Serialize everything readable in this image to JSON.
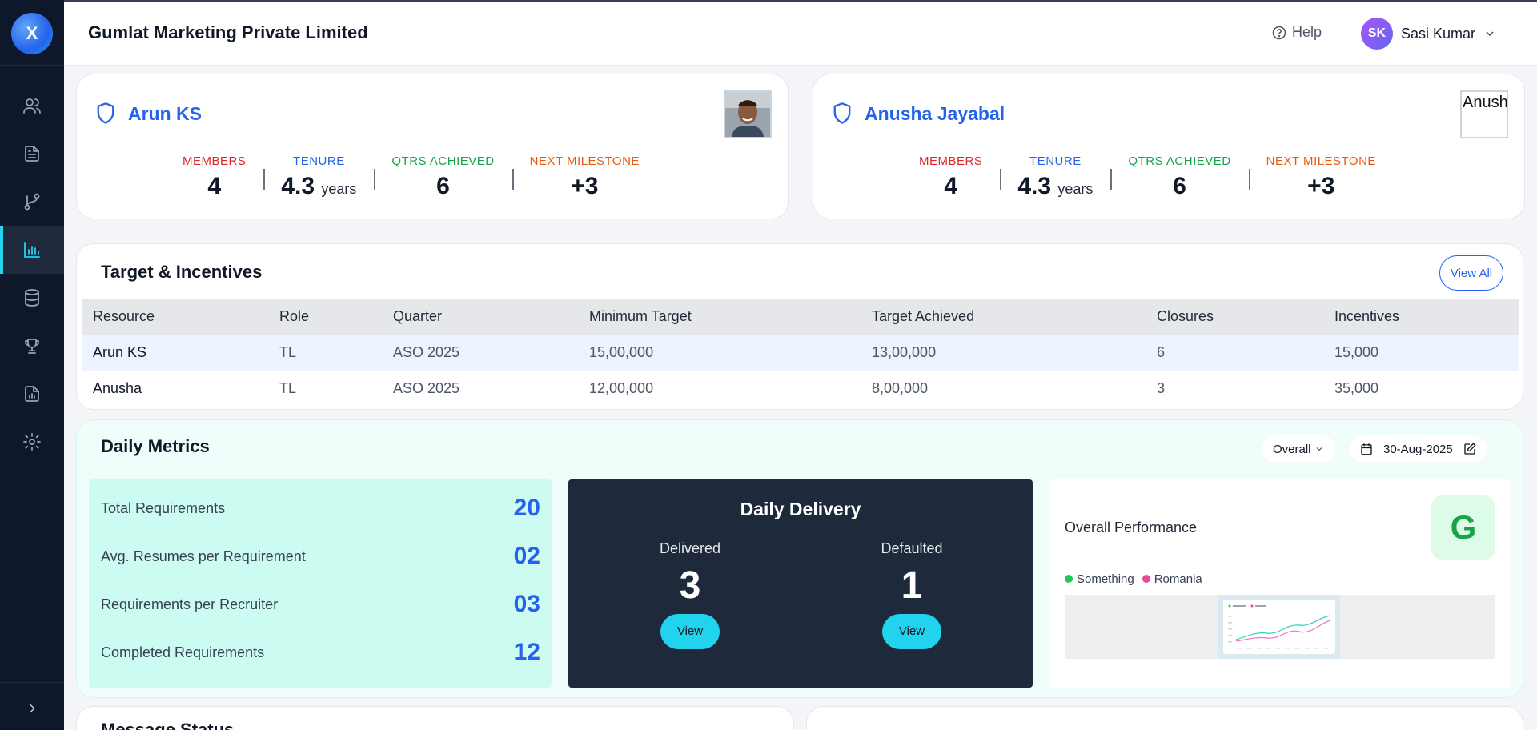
{
  "sidebar": {
    "logo": "X",
    "items": [
      {
        "icon": "users-icon"
      },
      {
        "icon": "document-icon"
      },
      {
        "icon": "git-branch-icon"
      },
      {
        "icon": "bar-chart-icon",
        "active": true
      },
      {
        "icon": "database-icon"
      },
      {
        "icon": "trophy-icon"
      },
      {
        "icon": "report-icon"
      },
      {
        "icon": "settings-icon"
      }
    ]
  },
  "header": {
    "company": "Gumlat Marketing Private Limited",
    "help": "Help",
    "user_initials": "SK",
    "user_name": "Sasi Kumar"
  },
  "profiles": [
    {
      "name": "Arun KS",
      "photo_alt": "",
      "stats": [
        {
          "label": "MEMBERS",
          "value": "4",
          "unit": ""
        },
        {
          "label": "TENURE",
          "value": "4.3",
          "unit": "years"
        },
        {
          "label": "QTRS ACHIEVED",
          "value": "6",
          "unit": ""
        },
        {
          "label": "NEXT MILESTONE",
          "value": "+3",
          "unit": ""
        }
      ]
    },
    {
      "name": "Anusha Jayabal",
      "photo_alt": "Anush",
      "stats": [
        {
          "label": "MEMBERS",
          "value": "4",
          "unit": ""
        },
        {
          "label": "TENURE",
          "value": "4.3",
          "unit": "years"
        },
        {
          "label": "QTRS ACHIEVED",
          "value": "6",
          "unit": ""
        },
        {
          "label": "NEXT MILESTONE",
          "value": "+3",
          "unit": ""
        }
      ]
    }
  ],
  "targets": {
    "title": "Target & Incentives",
    "view_all": "View All",
    "columns": [
      "Resource",
      "Role",
      "Quarter",
      "Minimum Target",
      "Target Achieved",
      "Closures",
      "Incentives"
    ],
    "rows": [
      [
        "Arun KS",
        "TL",
        "ASO 2025",
        "15,00,000",
        "13,00,000",
        "6",
        "15,000"
      ],
      [
        "Anusha",
        "TL",
        "ASO 2025",
        "12,00,000",
        "8,00,000",
        "3",
        "35,000"
      ]
    ]
  },
  "daily": {
    "title": "Daily Metrics",
    "filter": "Overall",
    "date": "30-Aug-2025",
    "metrics": [
      {
        "label": "Total Requirements",
        "value": "20"
      },
      {
        "label": "Avg. Resumes per Requirement",
        "value": "02"
      },
      {
        "label": "Requirements per Recruiter",
        "value": "03"
      },
      {
        "label": "Completed Requirements",
        "value": "12"
      }
    ],
    "delivery": {
      "title": "Daily Delivery",
      "delivered_label": "Delivered",
      "delivered_value": "3",
      "defaulted_label": "Defaulted",
      "defaulted_value": "1",
      "view": "View"
    },
    "performance": {
      "title": "Overall Performance",
      "grade": "G",
      "legend": [
        {
          "name": "Something",
          "color": "#22c55e"
        },
        {
          "name": "Romania",
          "color": "#ec4899"
        }
      ]
    }
  },
  "bottom": {
    "message_status": "Message Status"
  },
  "colors": {
    "sidebar_bg": "#0f172a",
    "accent": "#22d3ee",
    "primary": "#2563eb"
  }
}
